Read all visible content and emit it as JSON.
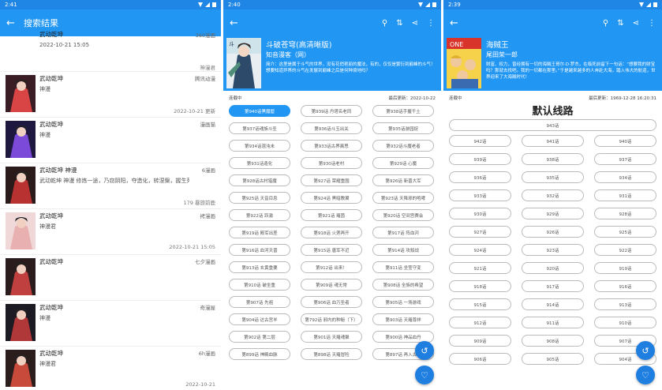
{
  "screen1": {
    "time": "2:41",
    "title": "搜索结果",
    "results": [
      {
        "title": "武动乾坤",
        "source": "360漫画",
        "date": "2022-10-21 15:05",
        "sub": "神漫君"
      },
      {
        "title": "武动乾坤",
        "source": "腾讯动漫",
        "author": "神漫",
        "date": "2022-10-21 更新"
      },
      {
        "title": "武动乾坤",
        "source": "漫画猫",
        "author": "神漫"
      },
      {
        "title": "武动乾坤 神漫",
        "source": "6漫画",
        "desc": "武动乾坤 神漫 修炼一途，乃窃阴阳，夺造化，转涅槃，握生死...",
        "date": "179 暴旅前鹿"
      },
      {
        "title": "武动乾坤",
        "source": "拷漫画",
        "author": "神漫君",
        "date": "2022-10-21 15:05"
      },
      {
        "title": "武动乾坤",
        "source": "七夕漫画"
      },
      {
        "title": "武动乾坤",
        "source": "奇漫屋",
        "author": "神漫"
      },
      {
        "title": "武动乾坤",
        "source": "6h漫画",
        "author": "神漫君",
        "date": "2022-10-21"
      }
    ]
  },
  "screen2": {
    "time": "2:40",
    "title": "斗破苍穹(高清晰版)",
    "author": "知音漫客（网）",
    "desc": "简介：这里是属于斗气的世界，没有花俏艳丽的魔法，有的，仅仅是繁衍到巅峰的斗气！想要知道异界的斗气在发展到巅峰之后是何种境地吗？",
    "status": "连载中",
    "updated": "最后更新：2022-10-22",
    "chapters": [
      "第940话黑魔窟",
      "第939话 丹塔名老同",
      "第938话手握千土",
      "第937话魂族斗圣",
      "第936话斗玉出关",
      "第935话游园捉",
      "第934话混沌未",
      "第933话古界离思",
      "第932话斗魔老者",
      "第931话造化",
      "第930话老村",
      "第929话 心魔",
      "第928话古村猎魔",
      "第927话 荣耀重围",
      "第926话 新晋大军",
      "第925话 天音目息",
      "第924话 黑暗教翼",
      "第923话 天降邪的咆哮",
      "第922话 跃激",
      "第921话 羅茵",
      "第920话 空间宫赛会",
      "第919话 殿军出差",
      "第918话 火莲再开",
      "第917话 阵血河",
      "第916话 血河天晋",
      "第915话 唐军不近",
      "第914话 攻殺战",
      "第913话 玄黄重要",
      "第912话 出来！",
      "第911话 坐莹守变",
      "第910话 破坐重",
      "第909话 魂无常",
      "第908话 全族的希望",
      "第907话 先祖",
      "第906话 血万圣者",
      "第905话 一场游戏",
      "第904话 达古宫羊",
      "第792话 邪内的种秘（下）",
      "第903话 天羅尊祥",
      "第902话 第二层",
      "第901话 天羅魂聚",
      "第900话 神品血丹",
      "第899话 神殿血脉",
      "第898话 天羅冒险",
      "第897话 再入古殿"
    ],
    "selected": 0
  },
  "screen3": {
    "time": "2:39",
    "title": "海贼王",
    "author": "尾田荣一郎",
    "desc": "财富、权力，曾经拥有一切的海贼王哥尔·D·罗杰，在临死前留下一句话：“想要我的财宝吗？那就去找吧。我的一切都在那里。”于是越来越多的人奔赴大海，踏入伟大的航道，世界迎来了大海贼时代！",
    "status": "连载中",
    "updated": "最后更新：1969-12-28 16:20:31",
    "line_title": "默认线路",
    "top_chapter": "943话",
    "chapters": [
      "942话",
      "941话",
      "940话",
      "939话",
      "938话",
      "937话",
      "936话",
      "935话",
      "934话",
      "933话",
      "932话",
      "931话",
      "930话",
      "929话",
      "928话",
      "927话",
      "926话",
      "925话",
      "924话",
      "923话",
      "922话",
      "921话",
      "920话",
      "919话",
      "918话",
      "917话",
      "916话",
      "915话",
      "914话",
      "913话",
      "912话",
      "911话",
      "910话",
      "909话",
      "908话",
      "907话",
      "906话",
      "905话",
      "904话"
    ]
  },
  "icons": {
    "back": "arrow-back-icon",
    "search": "search-icon",
    "sort": "sort-icon",
    "share": "share-icon",
    "more": "more-vert-icon",
    "history": "history-icon",
    "favorite": "heart-icon"
  }
}
